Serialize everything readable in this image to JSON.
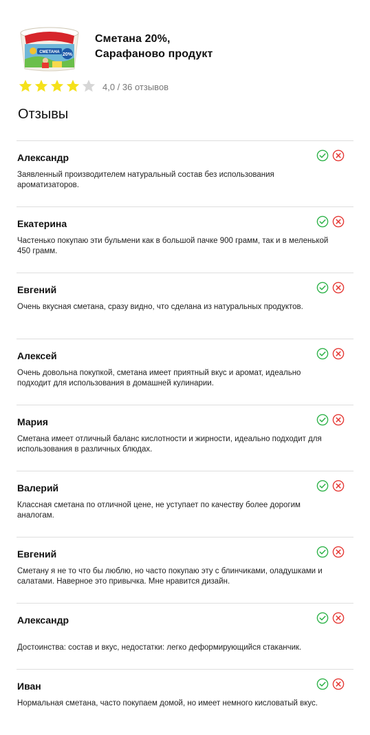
{
  "product": {
    "title_line1": "Сметана 20%,",
    "title_line2": "Сарафаново продукт",
    "brand_on_package": "САРАФАНОВО",
    "package_label": "СМЕТАНА",
    "package_badge": "20%"
  },
  "rating": {
    "value": 4,
    "max": 5,
    "text": "4,0 / 36 отзывов",
    "star_color": "#f5e11a",
    "star_empty_color": "#d6d6d6"
  },
  "section_title": "Отзывы",
  "colors": {
    "approve": "#2fb34a",
    "reject": "#e53935"
  },
  "reviews": [
    {
      "author": "Александр",
      "text": "Заявленный производителем натуральный состав без использования ароматизаторов."
    },
    {
      "author": "Екатерина",
      "text": "Частенько покупаю эти бульмени как в большой пачке 900 грамм, так и в меленькой 450 грамм."
    },
    {
      "author": "Евгений",
      "text": "Очень вкусная сметана, сразу видно, что сделана из натуральных продуктов."
    },
    {
      "author": "Алексей",
      "text": "Очень довольна покупкой, сметана имеет приятный вкус и аромат, идеально подходит для использования в домашней кулинарии."
    },
    {
      "author": "Мария",
      "text": "Сметана имеет отличный баланс кислотности и жирности, идеально подходит для использования в различных блюдах."
    },
    {
      "author": "Валерий",
      "text": "Классная сметана по отличной цене, не уступает по качеству более дорогим аналогам."
    },
    {
      "author": "Евгений",
      "text": "Сметану я не то что бы люблю, но часто покупаю эту с блинчиками, оладушками и салатами. Наверное это привычка. Мне нравится дизайн."
    },
    {
      "author": "Александр",
      "text": "Достоинства: состав и вкус, недостатки: легко деформирующийся стаканчик."
    },
    {
      "author": "Иван",
      "text": "Нормальная сметана, часто покупаем домой, но имеет немного кисловатый вкус."
    }
  ]
}
